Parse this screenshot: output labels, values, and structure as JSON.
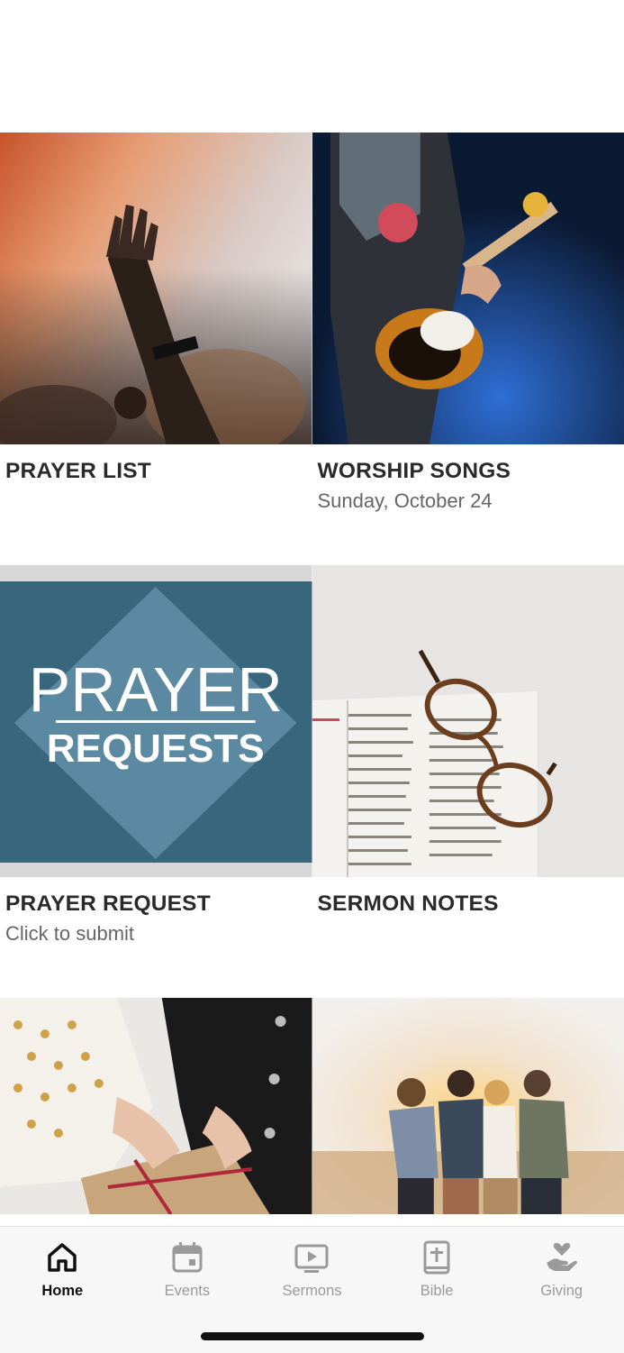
{
  "tiles": [
    {
      "title": "PRAYER LIST",
      "subtitle": ""
    },
    {
      "title": "WORSHIP SONGS",
      "subtitle": "Sunday, October 24"
    },
    {
      "title": "PRAYER REQUEST",
      "subtitle": "Click to submit"
    },
    {
      "title": "SERMON NOTES",
      "subtitle": ""
    }
  ],
  "prayer_requests_graphic": {
    "line1": "PRAYER",
    "line2": "REQUESTS"
  },
  "tabbar": {
    "active": "Home",
    "items": [
      {
        "label": "Home",
        "icon": "home-icon"
      },
      {
        "label": "Events",
        "icon": "calendar-icon"
      },
      {
        "label": "Sermons",
        "icon": "play-screen-icon"
      },
      {
        "label": "Bible",
        "icon": "bible-icon"
      },
      {
        "label": "Giving",
        "icon": "giving-hand-icon"
      }
    ]
  },
  "colors": {
    "active_tab": "#111111",
    "inactive_tab": "#9a9a9a",
    "title": "#2a2a2a",
    "subtitle": "#666666"
  }
}
